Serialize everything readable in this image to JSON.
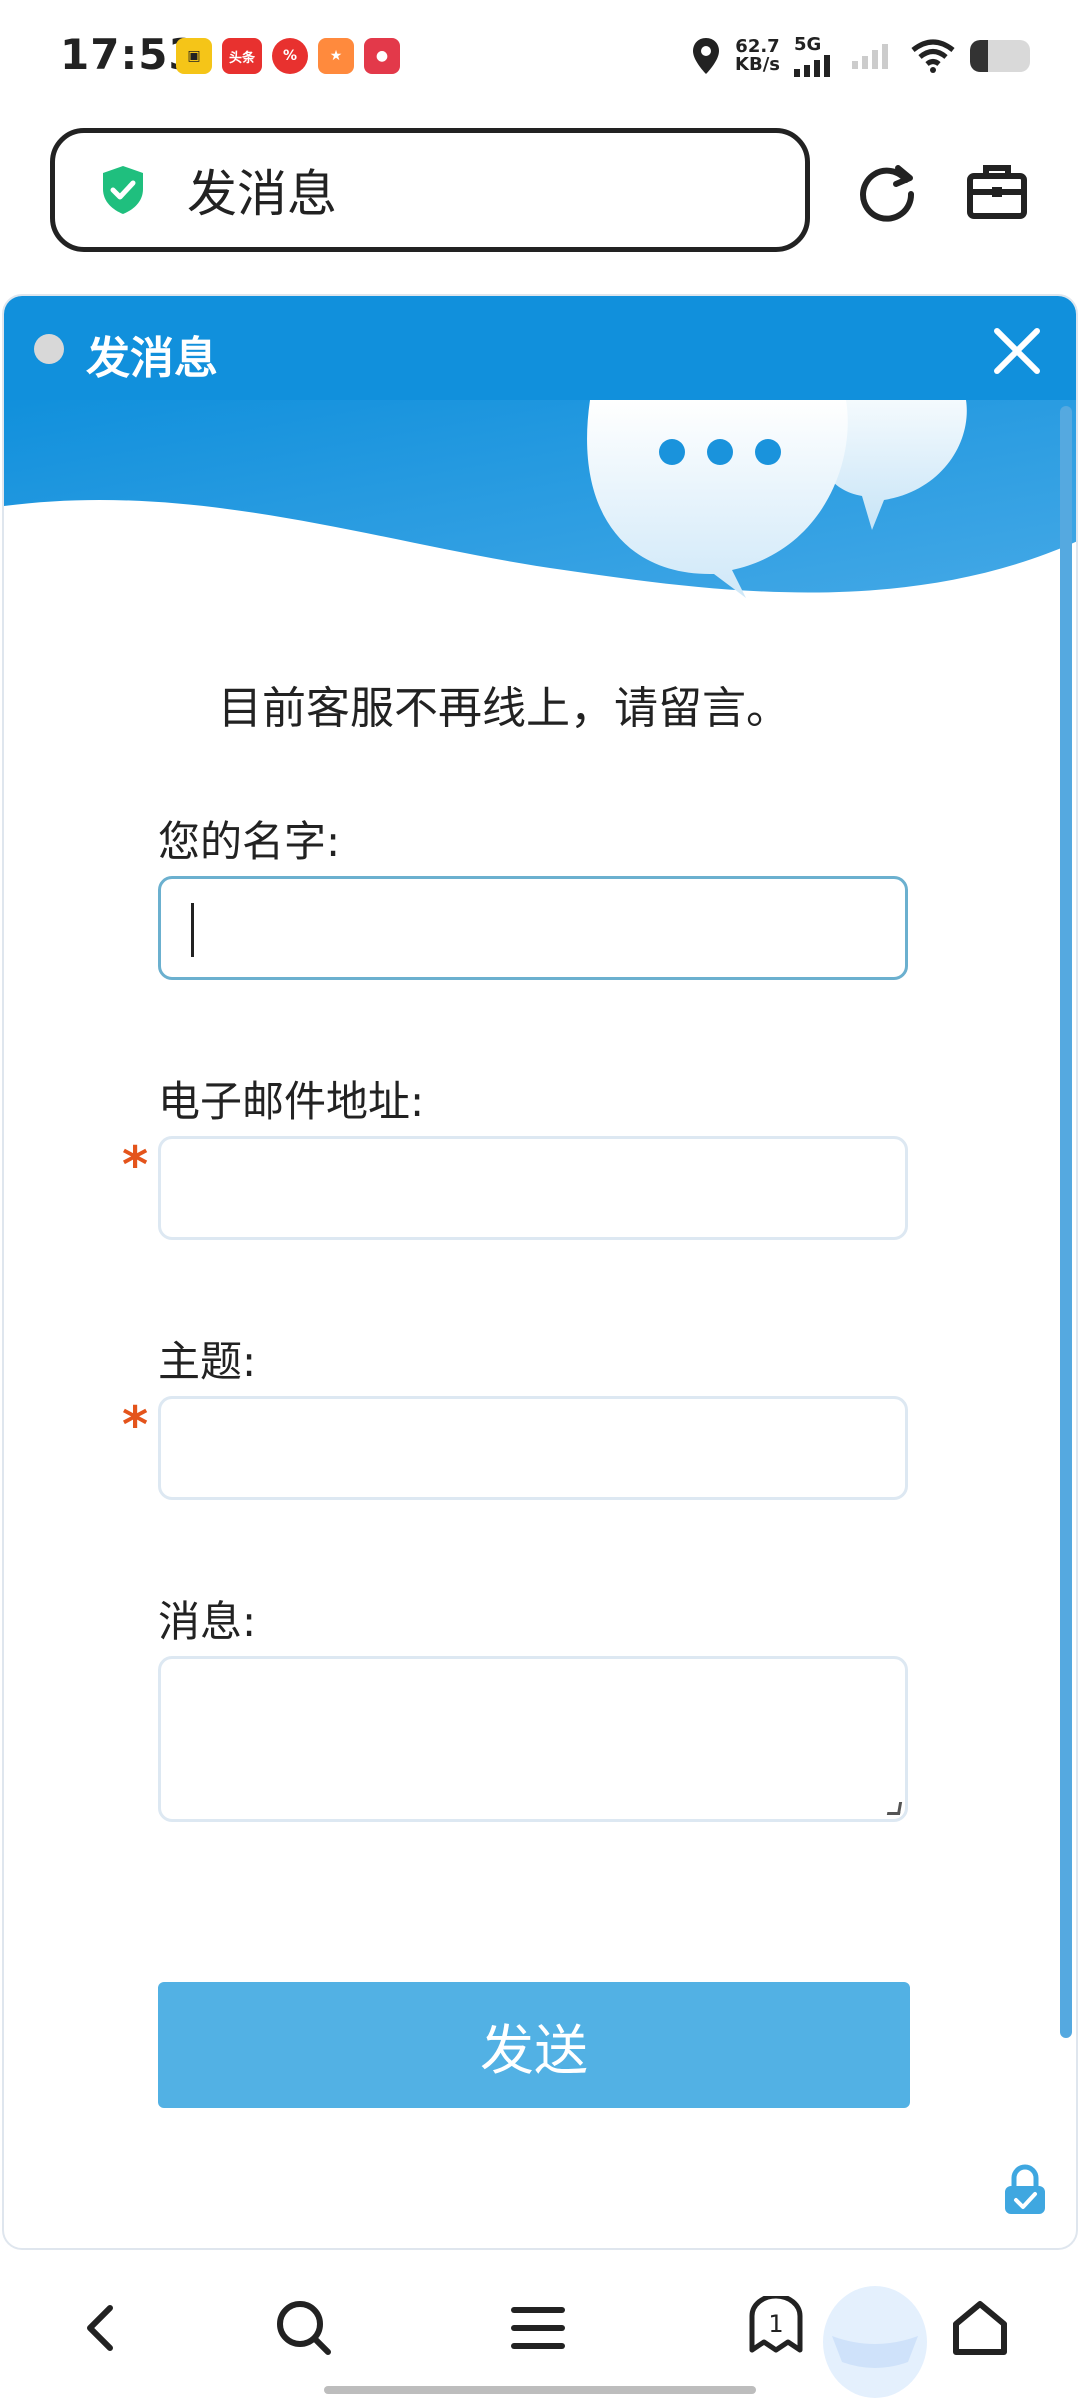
{
  "status_bar": {
    "time": "17:53",
    "net_speed_value": "62.7",
    "net_speed_unit": "KB/s",
    "network_type": "5G",
    "battery_level": 0.3,
    "app_icons": [
      "头条"
    ]
  },
  "browser": {
    "page_title": "发消息"
  },
  "chat_panel": {
    "title": "发消息",
    "notice": "目前客服不再线上，请留言。",
    "fields": {
      "name_label": "您的名字:",
      "email_label": "电子邮件地址:",
      "subject_label": "主题:",
      "message_label": "消息:",
      "required_mark": "*",
      "name_value": "",
      "email_value": "",
      "subject_value": "",
      "message_value": ""
    },
    "send_label": "发送"
  },
  "bottom_nav": {
    "tab_count": "1"
  },
  "colors": {
    "panel_header": "#1190dc",
    "send_button": "#52b1e4",
    "required_mark": "#e4541b",
    "shield": "#1fbf7e"
  }
}
